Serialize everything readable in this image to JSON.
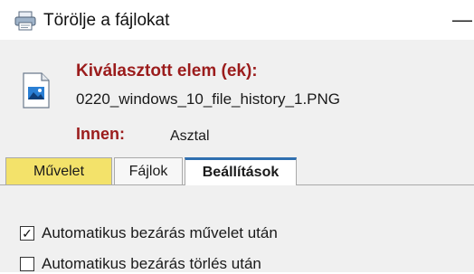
{
  "window": {
    "title": "Törölje a fájlokat",
    "minimize_glyph": "—",
    "app_icon": "printer-icon"
  },
  "selection": {
    "heading": "Kiválasztott elem (ek):",
    "file_icon": "image-file-icon",
    "file_name": "0220_windows_10_file_history_1.PNG",
    "from_label": "Innen:",
    "from_value": "Asztal"
  },
  "tabs": [
    {
      "label": "Művelet",
      "color": "#f3e26a"
    },
    {
      "label": "Fájlok",
      "color": "#f7f7f7"
    },
    {
      "label": "Beállítások",
      "color": "#ffffff",
      "active": true
    }
  ],
  "options": [
    {
      "label": "Automatikus bezárás művelet után",
      "checked": true
    },
    {
      "label": "Automatikus bezárás törlés után",
      "checked": false
    }
  ],
  "colors": {
    "heading_red": "#9b1c1c",
    "active_tab_accent": "#2f6fb0"
  }
}
